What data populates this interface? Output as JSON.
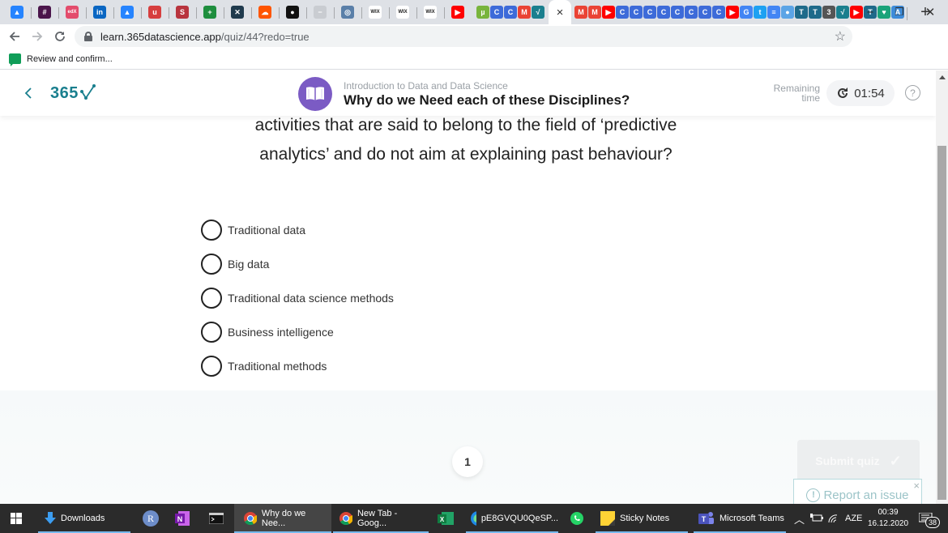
{
  "browser": {
    "pinned_tabs": [
      {
        "icon": "atlassian-icon",
        "glyph": "▲",
        "color": "#2684ff"
      },
      {
        "icon": "slack-icon",
        "glyph": "#",
        "color": "#4a154b"
      },
      {
        "icon": "edx-icon",
        "glyph": "edX",
        "color": "#e34c6c"
      },
      {
        "icon": "linkedin-icon",
        "glyph": "in",
        "color": "#0a66c2"
      },
      {
        "icon": "atlassian-icon",
        "glyph": "▲",
        "color": "#2684ff"
      },
      {
        "icon": "udemy-icon",
        "glyph": "u",
        "color": "#d63e3e"
      },
      {
        "icon": "coursera-icon",
        "glyph": "S",
        "color": "#b8343e"
      },
      {
        "icon": "toggl-icon",
        "glyph": "+",
        "color": "#1e8e3e"
      },
      {
        "icon": "xing-icon",
        "glyph": "✕",
        "color": "#1f3a4d"
      },
      {
        "icon": "soundcloud-icon",
        "glyph": "☁",
        "color": "#ff5500"
      },
      {
        "icon": "github-icon",
        "glyph": "●",
        "color": "#111111"
      },
      {
        "icon": "blank-page-icon",
        "glyph": "−",
        "color": "#c9ccd1"
      },
      {
        "icon": "image-icon",
        "glyph": "◎",
        "color": "#5a7fa8"
      },
      {
        "icon": "wix-icon",
        "glyph": "WIX",
        "color": "#ffffff"
      },
      {
        "icon": "wix-icon",
        "glyph": "WIX",
        "color": "#ffffff"
      },
      {
        "icon": "wix-icon",
        "glyph": "WIX",
        "color": "#ffffff"
      },
      {
        "icon": "youtube-icon",
        "glyph": "▶",
        "color": "#ff0000"
      }
    ],
    "mini_tabs_left": [
      {
        "icon": "utorrent-icon",
        "glyph": "µ",
        "color": "#78b43c"
      },
      {
        "icon": "coursera-c-icon",
        "glyph": "C",
        "color": "#3d6bd9"
      },
      {
        "icon": "coursera-c-icon",
        "glyph": "C",
        "color": "#3d6bd9"
      },
      {
        "icon": "gmail-icon",
        "glyph": "M",
        "color": "#ea4335"
      },
      {
        "icon": "365-logo-icon",
        "glyph": "√",
        "color": "#1a7f8e"
      }
    ],
    "active_tab_close": "×",
    "mini_tabs_right": [
      {
        "icon": "gmail-icon",
        "glyph": "M",
        "color": "#ea4335"
      },
      {
        "icon": "gmail-icon",
        "glyph": "M",
        "color": "#ea4335"
      },
      {
        "icon": "youtube-icon",
        "glyph": "▶",
        "color": "#ff0000"
      },
      {
        "icon": "coursera-c-icon",
        "glyph": "C",
        "color": "#3d6bd9"
      },
      {
        "icon": "coursera-c-icon",
        "glyph": "C",
        "color": "#3d6bd9"
      },
      {
        "icon": "coursera-c-icon",
        "glyph": "C",
        "color": "#3d6bd9"
      },
      {
        "icon": "coursera-c-icon",
        "glyph": "C",
        "color": "#3d6bd9"
      },
      {
        "icon": "coursera-c-icon",
        "glyph": "C",
        "color": "#3d6bd9"
      },
      {
        "icon": "coursera-c-icon",
        "glyph": "C",
        "color": "#3d6bd9"
      },
      {
        "icon": "coursera-c-icon",
        "glyph": "C",
        "color": "#3d6bd9"
      },
      {
        "icon": "coursera-c-icon",
        "glyph": "C",
        "color": "#3d6bd9"
      },
      {
        "icon": "youtube-icon",
        "glyph": "▶",
        "color": "#ff0000"
      },
      {
        "icon": "google-icon",
        "glyph": "G",
        "color": "#4285f4"
      },
      {
        "icon": "twitter-icon",
        "glyph": "t",
        "color": "#1da1f2"
      },
      {
        "icon": "docs-icon",
        "glyph": "≡",
        "color": "#4285f4"
      },
      {
        "icon": "bubble-icon",
        "glyph": "●",
        "color": "#5ba4e6"
      },
      {
        "icon": "template-icon",
        "glyph": "T",
        "color": "#1e6a8a"
      },
      {
        "icon": "template-icon",
        "glyph": "T",
        "color": "#1e6a8a"
      },
      {
        "icon": "refresh-app-icon",
        "glyph": "3",
        "color": "#555555"
      },
      {
        "icon": "365-logo-icon",
        "glyph": "√",
        "color": "#1a7f8e"
      },
      {
        "icon": "youtube-icon",
        "glyph": "▶",
        "color": "#ff0000"
      },
      {
        "icon": "template-icon",
        "glyph": "T",
        "color": "#1e6a8a"
      },
      {
        "icon": "map-pin-icon",
        "glyph": "♥",
        "color": "#1aa37a"
      },
      {
        "icon": "font-a-icon",
        "glyph": "A",
        "color": "#3d8bd9"
      }
    ],
    "new_tab": "+",
    "window_controls": {
      "minimize": "−",
      "restore": "❐",
      "close": "✕"
    },
    "url_host": "learn.365datascience.app",
    "url_path": "/quiz/44?redo=true",
    "bookmark_label": "Review and confirm..."
  },
  "header": {
    "logo_text": "365",
    "course_name": "Introduction to Data and Data Science",
    "lesson_title": "Why do we Need each of these Disciplines?",
    "remaining_label_1": "Remaining",
    "remaining_label_2": "time",
    "timer_value": "01:54",
    "help_glyph": "?"
  },
  "question": {
    "line_1": "activities that are said to belong to the field of ‘predictive",
    "line_2": "analytics’ and do not aim at explaining past behaviour?"
  },
  "options": [
    {
      "label": "Traditional data",
      "selected": false
    },
    {
      "label": "Big data",
      "selected": false
    },
    {
      "label": "Traditional data science methods",
      "selected": false
    },
    {
      "label": "Business intelligence",
      "selected": false
    },
    {
      "label": "Traditional methods",
      "selected": false
    }
  ],
  "footer": {
    "page_number": "1",
    "submit_label": "Submit quiz",
    "report_label": "Report an issue",
    "report_close": "×"
  },
  "taskbar": {
    "items": [
      {
        "label": "Downloads",
        "icon": "download-arrow-icon"
      },
      {
        "label": "Why do we Nee...",
        "icon": "chrome-icon"
      },
      {
        "label": "New Tab - Goog...",
        "icon": "chrome-icon"
      },
      {
        "label": "pE8GVQU0QeSP...",
        "icon": "edge-icon"
      },
      {
        "label": "Sticky Notes",
        "icon": "sticky-notes-icon"
      },
      {
        "label": "Microsoft Teams",
        "icon": "teams-icon"
      }
    ],
    "language": "AZE",
    "time": "00:39",
    "date": "16.12.2020",
    "notification_count": "38"
  }
}
